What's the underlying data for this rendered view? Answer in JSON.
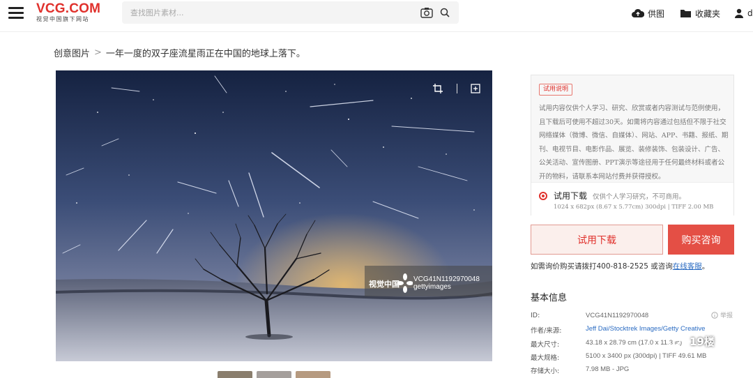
{
  "header": {
    "logo_main": "VCG.COM",
    "logo_sub": "视觉中国旗下网站",
    "search_placeholder": "查找图片素材...",
    "nav": {
      "supply": "供图",
      "favorites": "收藏夹",
      "user": "d"
    }
  },
  "breadcrumb": {
    "root": "创意图片",
    "sep": ">",
    "current": "一年一度的双子座流星雨正在中国的地球上落下。"
  },
  "photo": {
    "watermark_logo": "视觉中国",
    "watermark_id": "VCG41N1192970048",
    "watermark_getty": "gettyimages"
  },
  "license_panel": {
    "badge": "试用说明",
    "description": "试用内容仅供个人学习、研究、欣赏或者内容测试与范例使用，且下载后可使用不超过30天。如需将内容通过包括但不限于社交网络媒体（微博、微信、自媒体）、网站、APP、书籍、报纸、期刊、电视节目、电影作品、展览、装修装饰、包装设计、广告、公关活动、宣传图册、PPT演示等途径用于任何最终材料或者公开的物料，请联系本网站付费并获得授权。",
    "option_title": "试用下载",
    "option_note": "仅供个人学习研究，不可商用。",
    "option_spec": "1024 x 682px (8.67 x 5.77cm) 300dpi | TIFF 2.00 MB"
  },
  "buttons": {
    "trial": "试用下载",
    "buy": "购买咨询"
  },
  "hint": {
    "text": "如需询价购买请拨打400-818-2525 或咨询",
    "link": "在线客服",
    "end": "。"
  },
  "basic_info": {
    "title": "基本信息",
    "report": "举报",
    "rows": [
      {
        "label": "ID:",
        "value": "VCG41N1192970048"
      },
      {
        "label": "作者/来源:",
        "value": "Jeff Dai/Stocktrek Images/Getty Creative"
      },
      {
        "label": "最大尺寸:",
        "value": "43.18 x 28.79 cm (17.0 x 11.3 in)"
      },
      {
        "label": "最大规格:",
        "value": "5100 x 3400 px (300dpi) | TIFF 49.61 MB"
      },
      {
        "label": "存储大小:",
        "value": "7.98 MB - JPG"
      }
    ]
  },
  "overlay": {
    "text": "19楼"
  },
  "colors": {
    "brand": "#e0312c",
    "link": "#2a6bc2",
    "buy_button": "#e44f45"
  }
}
